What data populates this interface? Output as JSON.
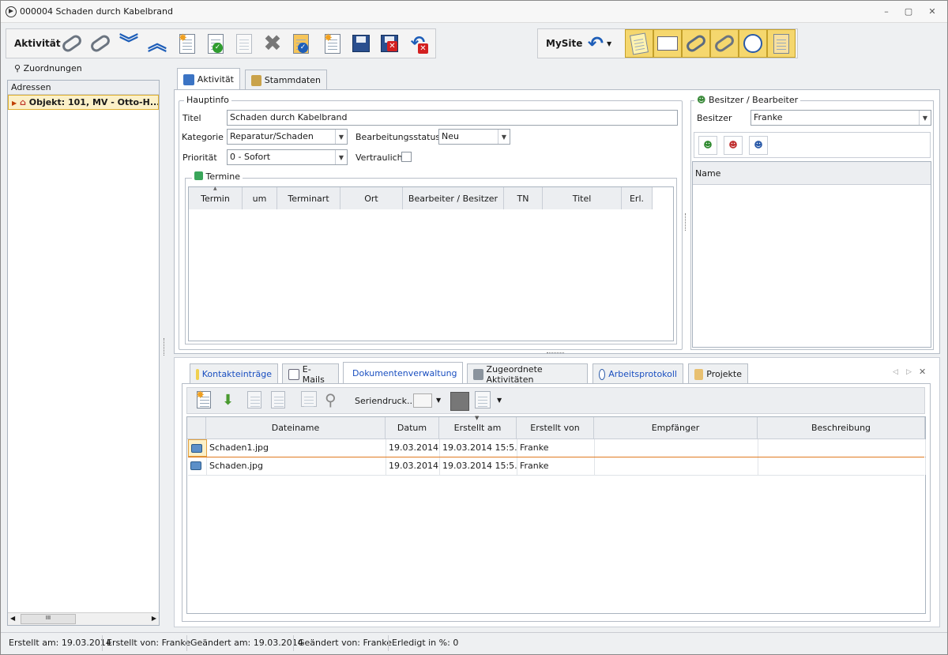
{
  "window": {
    "title": "000004 Schaden durch Kabelbrand",
    "minimize": "–",
    "restore": "▢",
    "close": "✕"
  },
  "toolbar": {
    "group_label": "Aktivität",
    "mysite_label": "MySite"
  },
  "sidebar": {
    "group_title": "Zuordnungen",
    "header": "Adressen",
    "item": "Objekt: 101, MV - Otto-H...",
    "scroll_thumb": "III"
  },
  "main_tabs": [
    {
      "label": "Aktivität"
    },
    {
      "label": "Stammdaten"
    }
  ],
  "hauptinfo": {
    "group_title": "Hauptinfo",
    "titel_label": "Titel",
    "titel_value": "Schaden durch Kabelbrand",
    "kategorie_label": "Kategorie",
    "kategorie_value": "Reparatur/Schaden",
    "bstatus_label": "Bearbeitungsstatus",
    "bstatus_value": "Neu",
    "prioritaet_label": "Priorität",
    "prioritaet_value": "0 - Sofort",
    "vertraulich_label": "Vertraulich"
  },
  "termine": {
    "group_title": "Termine",
    "columns": [
      "Termin",
      "um",
      "Terminart",
      "Ort",
      "Bearbeiter / Besitzer",
      "TN",
      "Titel",
      "Erl."
    ]
  },
  "besitzer": {
    "group_title": "Besitzer / Bearbeiter",
    "label": "Besitzer",
    "value": "Franke",
    "list_header": "Name"
  },
  "bottom_tabs": [
    {
      "label": "Kontakteinträge"
    },
    {
      "label": "E-Mails"
    },
    {
      "label": "Dokumentenverwaltung"
    },
    {
      "label": "Zugeordnete Aktivitäten"
    },
    {
      "label": "Arbeitsprotokoll"
    },
    {
      "label": "Projekte"
    }
  ],
  "doc_toolbar": {
    "seriendruck": "Seriendruck..."
  },
  "documents": {
    "columns": [
      "Dateiname",
      "Datum",
      "Erstellt am",
      "Erstellt von",
      "Empfänger",
      "Beschreibung"
    ],
    "rows": [
      {
        "name": "Schaden1.jpg",
        "datum": "19.03.2014",
        "erstellt_am": "19.03.2014  15:5...",
        "erstellt_von": "Franke",
        "empfaenger": "",
        "beschreibung": ""
      },
      {
        "name": "Schaden.jpg",
        "datum": "19.03.2014",
        "erstellt_am": "19.03.2014  15:5...",
        "erstellt_von": "Franke",
        "empfaenger": "",
        "beschreibung": ""
      }
    ]
  },
  "status": {
    "erstellt_am_label": "Erstellt am:",
    "erstellt_am": "19.03.2014",
    "erstellt_von_label": "Erstellt von:",
    "erstellt_von": "Franke",
    "geaendert_am_label": "Geändert am:",
    "geaendert_am": "19.03.2014",
    "geaendert_von_label": "Geändert von:",
    "geaendert_von": "Franke",
    "erledigt_label": "Erledigt in %:",
    "erledigt": "0"
  }
}
